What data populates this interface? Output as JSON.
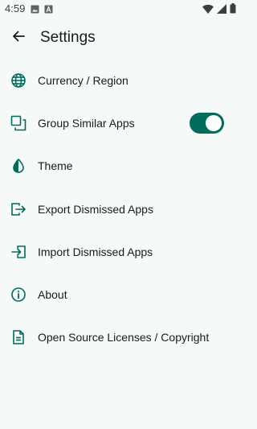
{
  "status_bar": {
    "time": "4:59",
    "left_icons": [
      "image-icon",
      "font-icon"
    ],
    "right_icons": [
      "wifi-icon",
      "signal-icon",
      "battery-icon"
    ]
  },
  "header": {
    "back_icon": "arrow-left-icon",
    "title": "Settings"
  },
  "settings": {
    "items": [
      {
        "label": "Currency / Region",
        "icon": "globe-icon"
      },
      {
        "label": "Group Similar Apps",
        "icon": "group-icon",
        "toggle_on": true
      },
      {
        "label": "Theme",
        "icon": "contrast-icon"
      },
      {
        "label": "Export Dismissed Apps",
        "icon": "export-icon"
      },
      {
        "label": "Import Dismissed Apps",
        "icon": "import-icon"
      },
      {
        "label": "About",
        "icon": "info-icon"
      },
      {
        "label": "Open Source Licenses / Copyright",
        "icon": "document-icon"
      }
    ]
  },
  "colors": {
    "accent": "#006c5b",
    "background": "#f5f9f7",
    "text": "#1a1c1b"
  }
}
